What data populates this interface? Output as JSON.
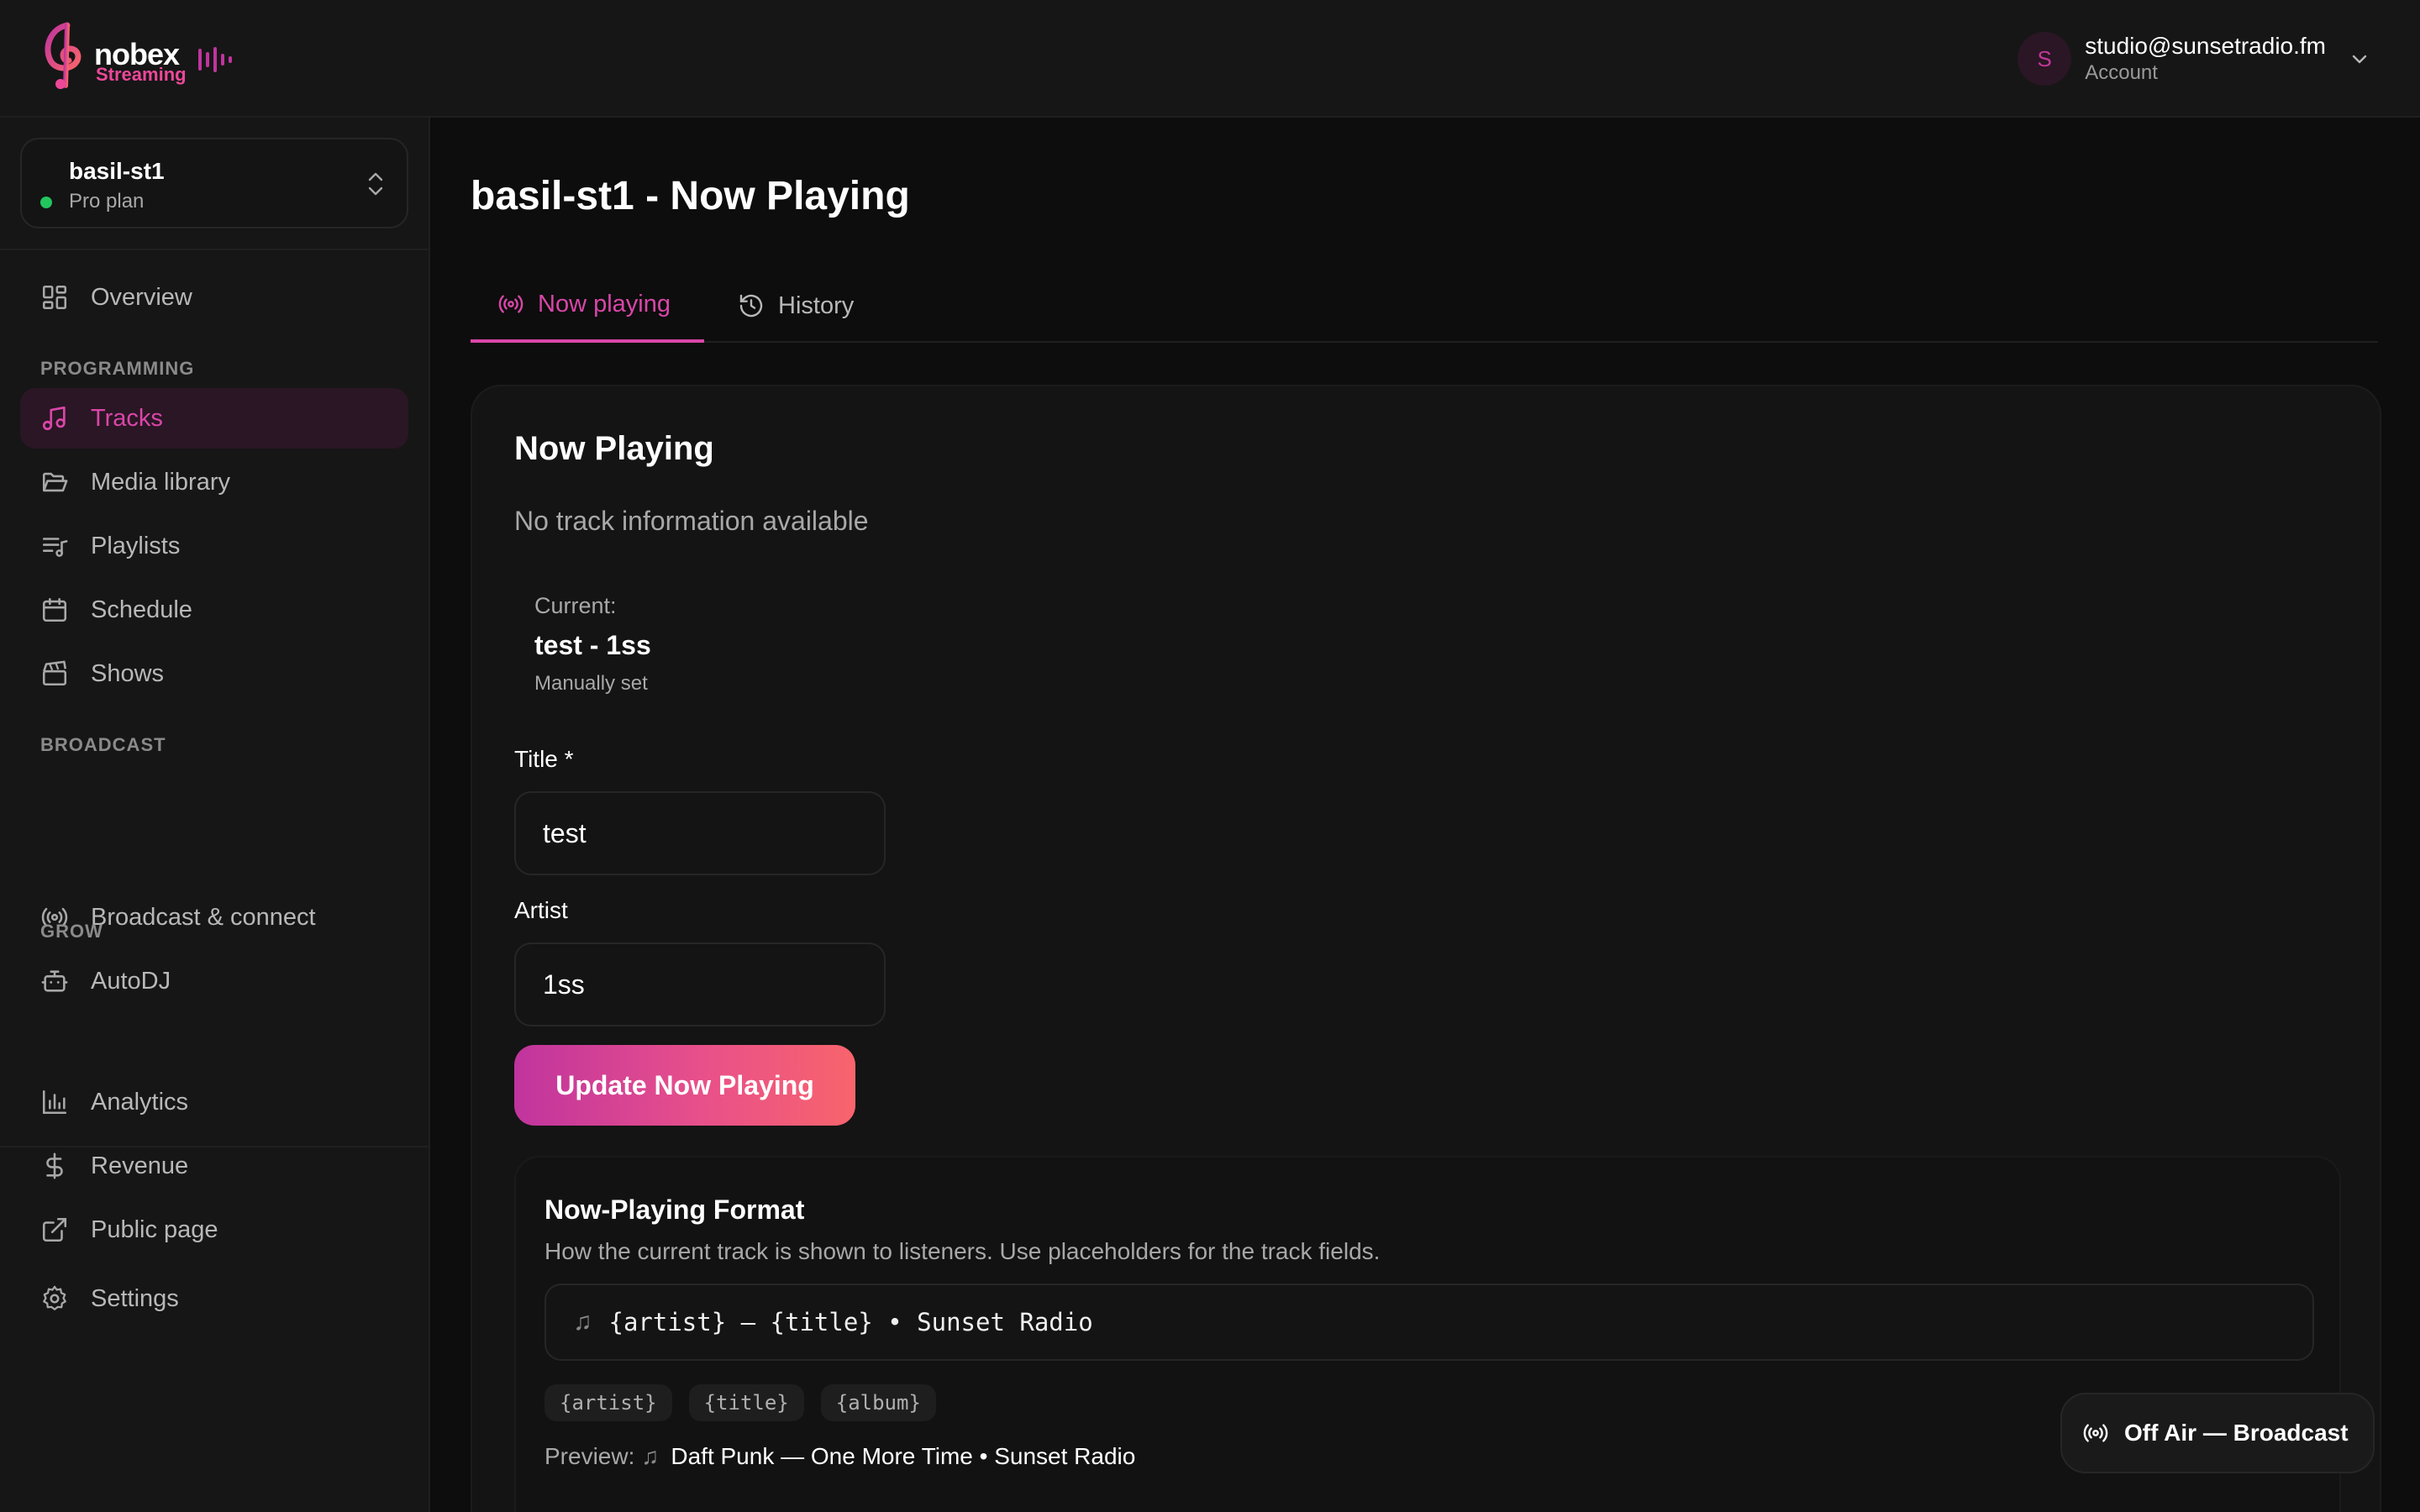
{
  "brand": {
    "name": "nobex",
    "sub": "Streaming",
    "colors": {
      "accent": "#d946a8",
      "accent_bg": "#2a1624",
      "online": "#22c55e"
    }
  },
  "account": {
    "initial": "S",
    "email": "studio@sunsetradio.fm",
    "role": "Account"
  },
  "station": {
    "name": "basil-st1",
    "plan": "Pro plan"
  },
  "sidebar": {
    "items": [
      {
        "label": "Overview",
        "icon": "grid-icon"
      },
      {
        "label": "Tracks",
        "icon": "music-note-icon"
      },
      {
        "label": "Media library",
        "icon": "folder-open-icon"
      },
      {
        "label": "Playlists",
        "icon": "playlist-icon"
      },
      {
        "label": "Schedule",
        "icon": "calendar-icon"
      },
      {
        "label": "Shows",
        "icon": "clapperboard-icon"
      },
      {
        "label": "Broadcast & connect",
        "icon": "broadcast-icon"
      },
      {
        "label": "AutoDJ",
        "icon": "robot-icon"
      },
      {
        "label": "Analytics",
        "icon": "bar-chart-icon"
      },
      {
        "label": "Revenue",
        "icon": "dollar-icon"
      },
      {
        "label": "Public page",
        "icon": "external-link-icon"
      },
      {
        "label": "Settings",
        "icon": "gear-icon"
      }
    ],
    "sections": {
      "programming": "PROGRAMMING",
      "broadcast": "BROADCAST",
      "grow": "GROW"
    }
  },
  "main": {
    "title": "basil-st1 - Now Playing",
    "tabs": [
      {
        "label": "Now playing"
      },
      {
        "label": "History"
      }
    ],
    "card": {
      "title": "Now Playing",
      "subtitle": "No track information available",
      "current": {
        "label": "Current:",
        "value": "test - 1ss",
        "note": "Manually set"
      },
      "form": {
        "title_label": "Title *",
        "title_value": "test",
        "artist_label": "Artist",
        "artist_value": "1ss",
        "submit_label": "Update Now Playing"
      },
      "format": {
        "title": "Now-Playing Format",
        "description": "How the current track is shown to listeners. Use placeholders for the track fields.",
        "glyph": "♫",
        "value": "{artist} — {title} • Sunset Radio",
        "chips": [
          "{artist}",
          "{title}",
          "{album}"
        ],
        "preview_label": "Preview:",
        "preview_value": "Daft Punk — One More Time • Sunset Radio"
      }
    }
  },
  "broadcast_status": {
    "label": "Off Air — Broadcast"
  }
}
